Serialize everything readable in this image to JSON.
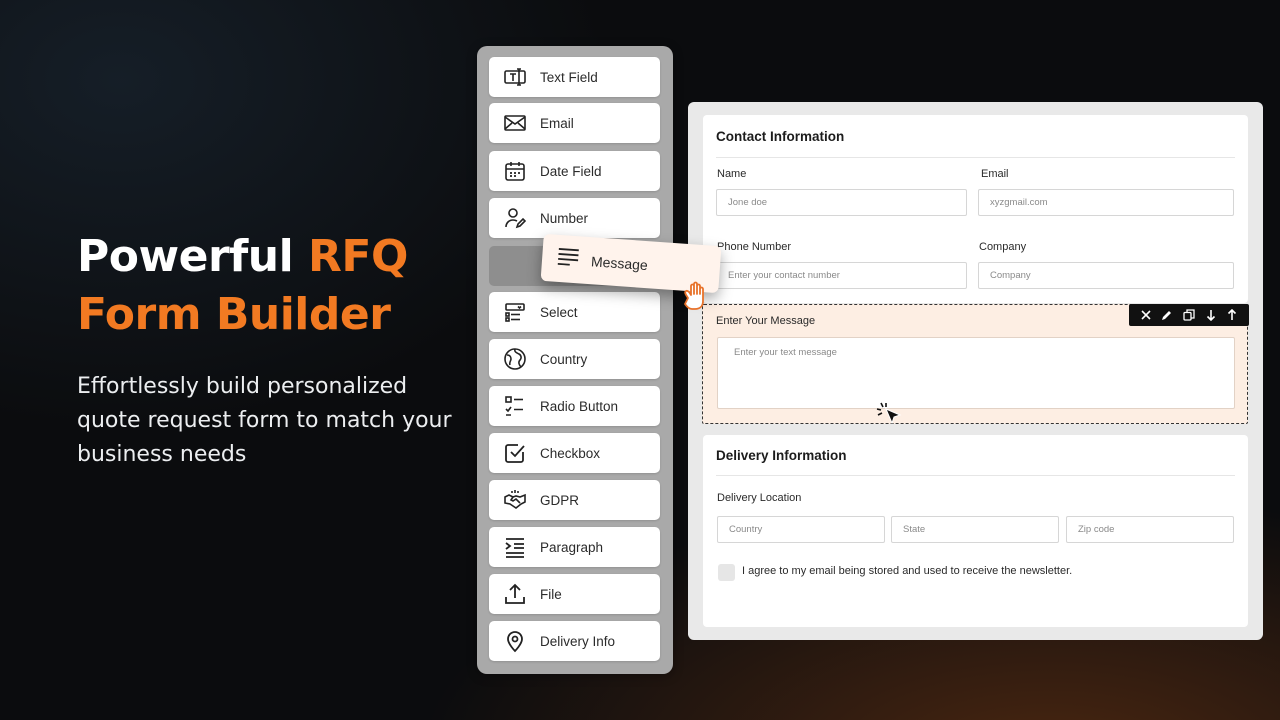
{
  "hero": {
    "title_line1_plain": "Powerful ",
    "title_line1_accent": "RFQ",
    "title_line2_accent": "Form Builder",
    "subtitle": "Effortlessly build personalized quote request form to match your business needs",
    "accent_color": "#f27a22"
  },
  "palette": {
    "items": [
      {
        "label": "Text Field",
        "icon": "text-field-icon"
      },
      {
        "label": "Email",
        "icon": "envelope-icon"
      },
      {
        "label": "Date Field",
        "icon": "calendar-icon"
      },
      {
        "label": "Number",
        "icon": "user-edit-icon"
      },
      {
        "label": "Select",
        "icon": "select-list-icon"
      },
      {
        "label": "Country",
        "icon": "globe-icon"
      },
      {
        "label": "Radio Button",
        "icon": "radio-list-icon"
      },
      {
        "label": "Checkbox",
        "icon": "checkbox-icon"
      },
      {
        "label": "GDPR",
        "icon": "handshake-icon"
      },
      {
        "label": "Paragraph",
        "icon": "indent-icon"
      },
      {
        "label": "File",
        "icon": "upload-icon"
      },
      {
        "label": "Delivery Info",
        "icon": "location-pin-icon"
      }
    ],
    "dragging": {
      "label": "Message",
      "icon": "text-lines-icon"
    }
  },
  "form": {
    "contact": {
      "title": "Contact Information",
      "name_label": "Name",
      "name_placeholder": "Jone doe",
      "email_label": "Email",
      "email_placeholder": "xyzgmail.com",
      "phone_label": "Phone Number",
      "phone_placeholder": "Enter your contact number",
      "company_label": "Company",
      "company_placeholder": "Company"
    },
    "message": {
      "label": "Enter Your Message",
      "placeholder": "Enter your text message",
      "toolbar": [
        "close-icon",
        "pencil-icon",
        "duplicate-icon",
        "arrow-down-icon",
        "arrow-up-icon"
      ]
    },
    "delivery": {
      "title": "Delivery Information",
      "location_label": "Delivery Location",
      "country_placeholder": "Country",
      "state_placeholder": "State",
      "zip_placeholder": "Zip code",
      "consent_label": "I agree to my email being stored and used to receive the newsletter."
    }
  }
}
